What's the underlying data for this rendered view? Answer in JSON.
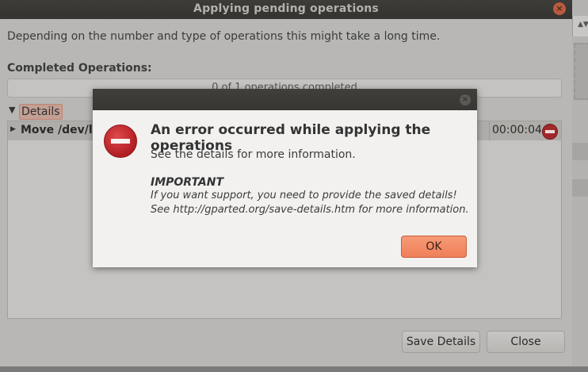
{
  "outer": {
    "title": "Applying pending operations",
    "description": "Depending on the number and type of operations this might take a long time.",
    "completed_label": "Completed Operations:",
    "progress_text": "0 of 1 operations completed",
    "progress_fraction": 0,
    "details_label": "Details",
    "operation": {
      "name": "Move /dev/lo",
      "elapsed": "00:00:04",
      "status_icon": "error-icon"
    },
    "save_details_label": "Save Details",
    "close_label": "Close"
  },
  "dialog": {
    "heading": "An error occurred while applying the operations",
    "subtext": "See the details for more information.",
    "important_label": "IMPORTANT",
    "important_line1": "If you want support, you need to provide the saved details!",
    "important_line2": "See http://gparted.org/save-details.htm for more information.",
    "ok_label": "OK",
    "icon": "error-icon"
  },
  "colors": {
    "accent": "#ef7f59",
    "error": "#b01d22",
    "titlebar": "#3a3935"
  }
}
